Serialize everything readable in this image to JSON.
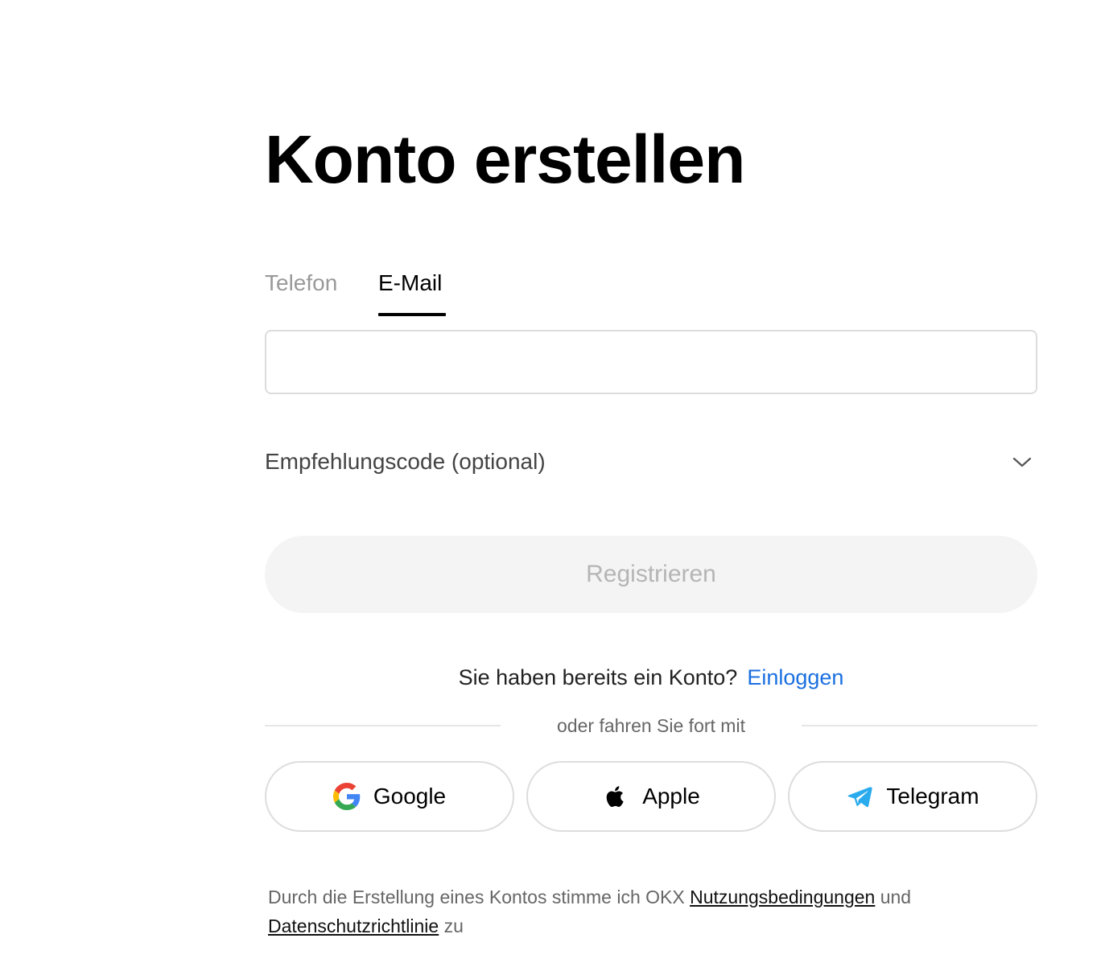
{
  "title": "Konto erstellen",
  "tabs": [
    {
      "label": "Telefon",
      "active": false
    },
    {
      "label": "E-Mail",
      "active": true
    }
  ],
  "email_input": {
    "value": "",
    "placeholder": ""
  },
  "referral": {
    "label": "Empfehlungscode (optional)",
    "icon": "chevron-down-icon"
  },
  "register_button": {
    "label": "Registrieren",
    "disabled": true
  },
  "login_prompt": {
    "text": "Sie haben bereits ein Konto?",
    "link_label": "Einloggen"
  },
  "divider_text": "oder fahren Sie fort mit",
  "social": [
    {
      "label": "Google",
      "icon": "google-icon"
    },
    {
      "label": "Apple",
      "icon": "apple-icon"
    },
    {
      "label": "Telegram",
      "icon": "telegram-icon"
    }
  ],
  "terms": {
    "prefix": "Durch die Erstellung eines Kontos stimme ich OKX",
    "terms_link": "Nutzungsbedingungen",
    "middle": "und",
    "privacy_link": "Datenschutzrichtlinie",
    "suffix": "zu"
  },
  "colors": {
    "link": "#1a6fe0",
    "button_disabled_bg": "#f4f4f4",
    "button_disabled_text": "#b5b5b5",
    "telegram": "#2aabee"
  }
}
